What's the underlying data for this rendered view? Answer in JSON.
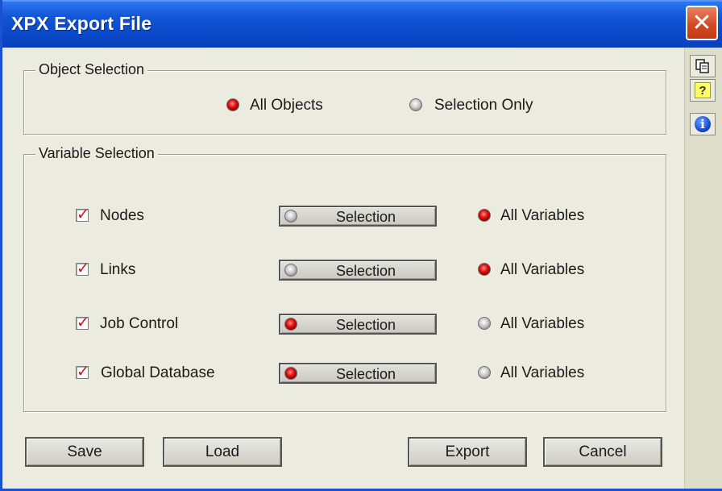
{
  "window": {
    "title": "XPX Export File",
    "close_symbol": "✕"
  },
  "side_toolbar": {
    "buttons": [
      {
        "icon": "copy-icon"
      },
      {
        "icon": "help-icon",
        "glyph": "?"
      },
      {
        "icon": "info-icon",
        "glyph": "i"
      }
    ]
  },
  "object_selection": {
    "legend": "Object Selection",
    "options": [
      {
        "label": "All Objects",
        "selected": true
      },
      {
        "label": "Selection Only",
        "selected": false
      }
    ]
  },
  "variable_selection": {
    "legend": "Variable Selection",
    "rows": [
      {
        "label": "Nodes",
        "checked": true,
        "selection_label": "Selection",
        "selection_active": false,
        "all_label": "All Variables",
        "all_active": true
      },
      {
        "label": "Links",
        "checked": true,
        "selection_label": "Selection",
        "selection_active": false,
        "all_label": "All Variables",
        "all_active": true
      },
      {
        "label": "Job Control",
        "checked": true,
        "selection_label": "Selection",
        "selection_active": true,
        "all_label": "All Variables",
        "all_active": false
      },
      {
        "label": "Global Database",
        "checked": true,
        "selection_label": "Selection",
        "selection_active": true,
        "all_label": "All Variables",
        "all_active": false
      }
    ]
  },
  "buttons": {
    "save": "Save",
    "load": "Load",
    "export": "Export",
    "cancel": "Cancel"
  },
  "colors": {
    "titlebar": "#0a49c9",
    "close": "#d2471f",
    "radio_on": "#e01010",
    "check": "#d11111"
  }
}
